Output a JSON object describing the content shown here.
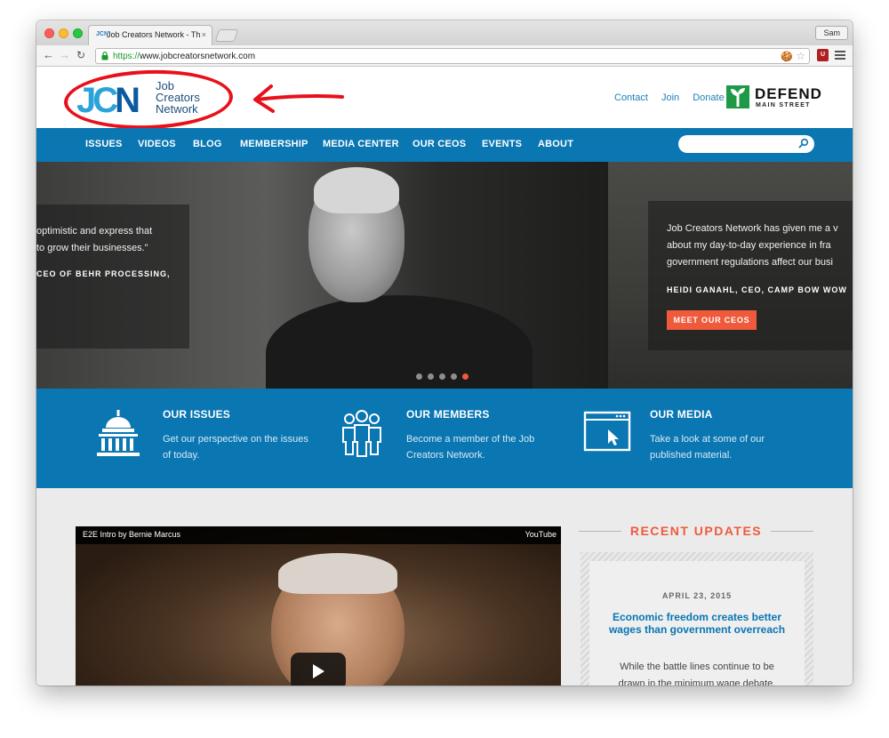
{
  "browser": {
    "tab_title": "Job Creators Network - Th",
    "tab_favicon_text": "JCN",
    "tab_close": "×",
    "user_name": "Sam",
    "url_scheme": "https://",
    "url_rest": "www.jobcreatorsnetwork.com",
    "ext_icon_text": "U"
  },
  "site": {
    "logo_letters": [
      "J",
      "C",
      "N"
    ],
    "logo_words": [
      "Job",
      "Creators",
      "Network"
    ],
    "header_links": [
      "Contact",
      "Join",
      "Donate"
    ],
    "defend_title": "DEFEND",
    "defend_subtitle": "MAIN STREET",
    "nav": [
      "ISSUES",
      "VIDEOS",
      "BLOG",
      "MEMBERSHIP",
      "MEDIA CENTER",
      "OUR CEOS",
      "EVENTS",
      "ABOUT"
    ],
    "search_placeholder": ""
  },
  "hero": {
    "left_quote_l1": "optimistic and express that",
    "left_quote_l2": "to grow their businesses.\"",
    "left_attr": "CEO OF BEHR PROCESSING,",
    "right_quote_l1": "Job Creators Network has given me a v",
    "right_quote_l2": "about my day-to-day experience in fra",
    "right_quote_l3": "government regulations affect our busi",
    "right_attr": "HEIDI GANAHL, CEO, CAMP BOW WOW",
    "cta": "MEET OUR CEOS",
    "slides_total": 5,
    "active_slide": 5
  },
  "features": [
    {
      "title": "OUR ISSUES",
      "desc": "Get our perspective on the issues of today.",
      "icon": "capitol-icon"
    },
    {
      "title": "OUR MEMBERS",
      "desc": "Become a member of the Job Creators Network.",
      "icon": "people-icon"
    },
    {
      "title": "OUR MEDIA",
      "desc": "Take a look at some of our published material.",
      "icon": "browser-cursor-icon"
    }
  ],
  "video": {
    "title": "E2E Intro by Bernie Marcus",
    "brand": "YouTube"
  },
  "updates": {
    "heading": "RECENT UPDATES",
    "date": "APRIL 23, 2015",
    "title": "Economic freedom creates better wages than government overreach",
    "excerpt": "While the battle lines continue to be drawn in the minimum wage debate,"
  },
  "colors": {
    "brand_blue": "#0a76b2",
    "accent_orange": "#ef5a3c",
    "annotation_red": "#e8101a"
  }
}
